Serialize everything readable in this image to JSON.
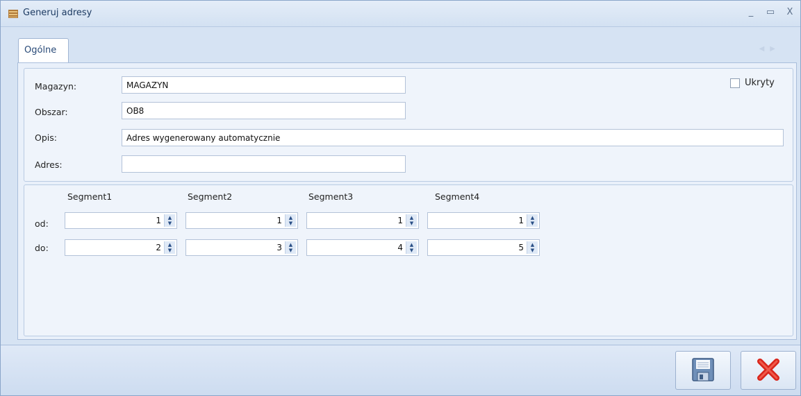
{
  "window": {
    "title": "Generuj adresy",
    "title_icon": "warehouse-icon",
    "controls": {
      "minimize": "_",
      "maximize": "▭",
      "close": "X"
    }
  },
  "tabs": [
    {
      "label": "Ogólne",
      "active": true
    }
  ],
  "form": {
    "magazyn_label": "Magazyn:",
    "magazyn_value": "MAGAZYN",
    "obszar_label": "Obszar:",
    "obszar_value": "OB8",
    "opis_label": "Opis:",
    "opis_value": "Adres wygenerowany automatycznie",
    "adres_label": "Adres:",
    "adres_value": "",
    "ukryty_label": "Ukryty",
    "ukryty_checked": false
  },
  "segments": {
    "headers": [
      "Segment1",
      "Segment2",
      "Segment3",
      "Segment4"
    ],
    "od_label": "od:",
    "do_label": "do:",
    "od_values": [
      "1",
      "1",
      "1",
      "1"
    ],
    "do_values": [
      "2",
      "3",
      "4",
      "5"
    ]
  },
  "footer": {
    "save_icon": "floppy-disk-icon",
    "cancel_icon": "red-x-icon"
  },
  "colors": {
    "accent": "#2a4b78",
    "cancel_red": "#d9261c"
  }
}
